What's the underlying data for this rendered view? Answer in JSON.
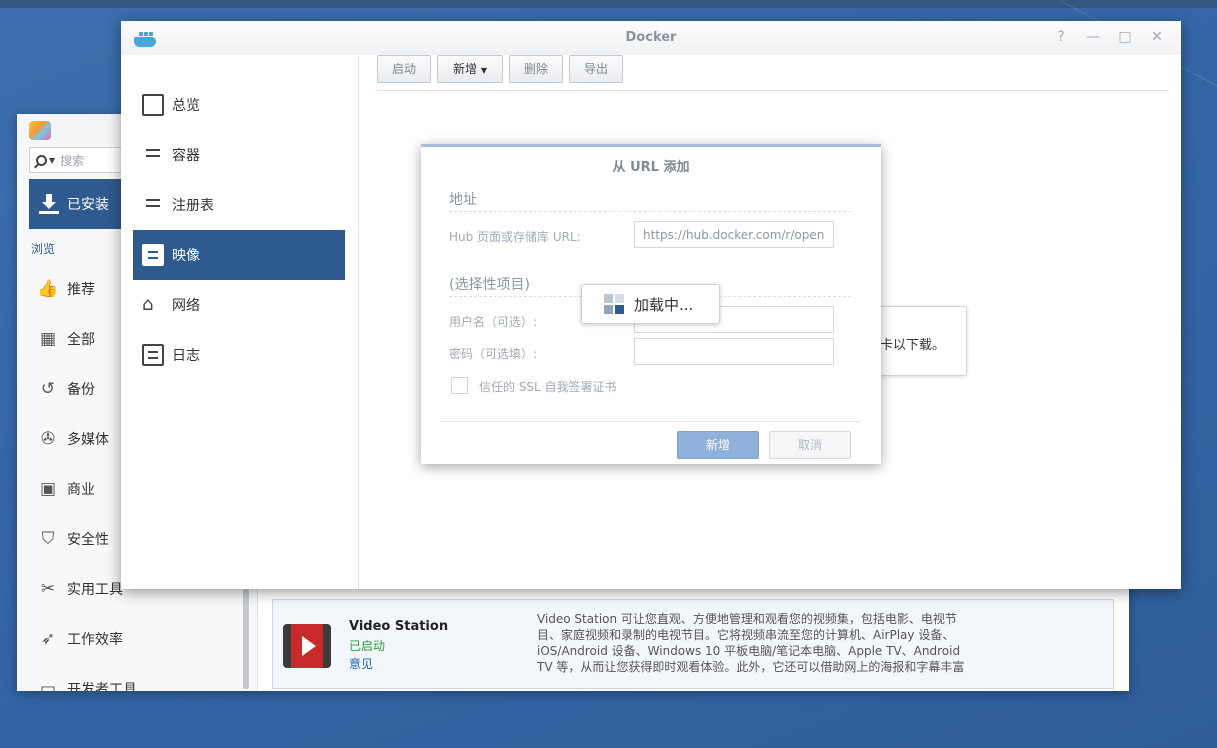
{
  "colors": {
    "desktop": "#3466a6",
    "accent": "#2f5a8f",
    "status_running": "#2f9b3a",
    "link": "#1a64b4"
  },
  "package_center": {
    "search_placeholder": "搜索",
    "installed_label": "已安装",
    "browse_label": "浏览",
    "categories": [
      {
        "label": "推荐",
        "icon": "thumbs-up-icon"
      },
      {
        "label": "全部",
        "icon": "grid-icon"
      },
      {
        "label": "备份",
        "icon": "backup-icon"
      },
      {
        "label": "多媒体",
        "icon": "film-reel-icon"
      },
      {
        "label": "商业",
        "icon": "briefcase-icon"
      },
      {
        "label": "安全性",
        "icon": "shield-icon"
      },
      {
        "label": "实用工具",
        "icon": "wrench-icon"
      },
      {
        "label": "工作效率",
        "icon": "rocket-icon"
      },
      {
        "label": "开发者工具",
        "icon": "terminal-icon"
      }
    ],
    "package": {
      "name": "Video Station",
      "status": "已启动",
      "link": "意见",
      "description": "Video Station 可让您直观、方便地管理和观看您的视频集，包括电影、电视节目、家庭视频和录制的电视节目。它将视频串流至您的计算机、AirPlay 设备、iOS/Android 设备、Windows 10 平板电脑/笔记本电脑、Apple TV、Android TV 等，从而让您获得即时观看体验。此外，它还可以借助网上的海报和字幕丰富"
    }
  },
  "docker": {
    "title": "Docker",
    "window_controls": {
      "help": "?",
      "minimize": "—",
      "maximize": "□",
      "close": "✕"
    },
    "nav": [
      {
        "label": "总览",
        "icon": "overview-icon"
      },
      {
        "label": "容器",
        "icon": "container-icon"
      },
      {
        "label": "注册表",
        "icon": "registry-icon"
      },
      {
        "label": "映像",
        "icon": "image-icon",
        "active": true
      },
      {
        "label": "网络",
        "icon": "network-icon"
      },
      {
        "label": "日志",
        "icon": "log-icon"
      }
    ],
    "toolbar": {
      "start": "启动",
      "add": "新增",
      "delete": "删除",
      "export": "导出"
    },
    "toast_text": "卡以下载。"
  },
  "modal": {
    "title": "从 URL 添加",
    "address_section": "地址",
    "url_label": "Hub 页面或存储库 URL:",
    "url_value": "https://hub.docker.com/r/open",
    "optional_section": "(选择性项目)",
    "username_label": "用户名（可选）:",
    "password_label": "密码（可选填）:",
    "ssl_label": "信任的 SSL 自我签署证书",
    "ok_button": "新增",
    "cancel_button": "取消"
  },
  "loading": {
    "text": "加载中..."
  }
}
